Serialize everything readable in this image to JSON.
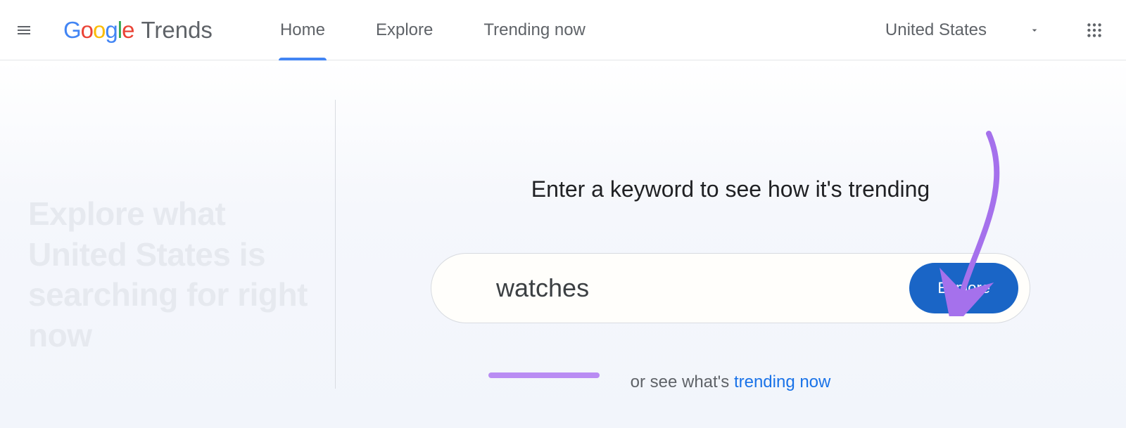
{
  "header": {
    "logo": {
      "google": "Google",
      "product": "Trends"
    },
    "nav": [
      {
        "label": "Home",
        "active": true
      },
      {
        "label": "Explore",
        "active": false
      },
      {
        "label": "Trending now",
        "active": false
      }
    ],
    "region": {
      "selected": "United States"
    }
  },
  "left": {
    "tagline": "Explore what United States is searching for right now"
  },
  "main": {
    "prompt": "Enter a keyword to see how it's trending",
    "search_value": "watches",
    "explore_label": "Explore",
    "alt_prefix": "or see what's ",
    "alt_link": "trending now"
  },
  "annotation": {
    "arrow_color": "#a571ec",
    "underline_color": "#b98cf3"
  }
}
